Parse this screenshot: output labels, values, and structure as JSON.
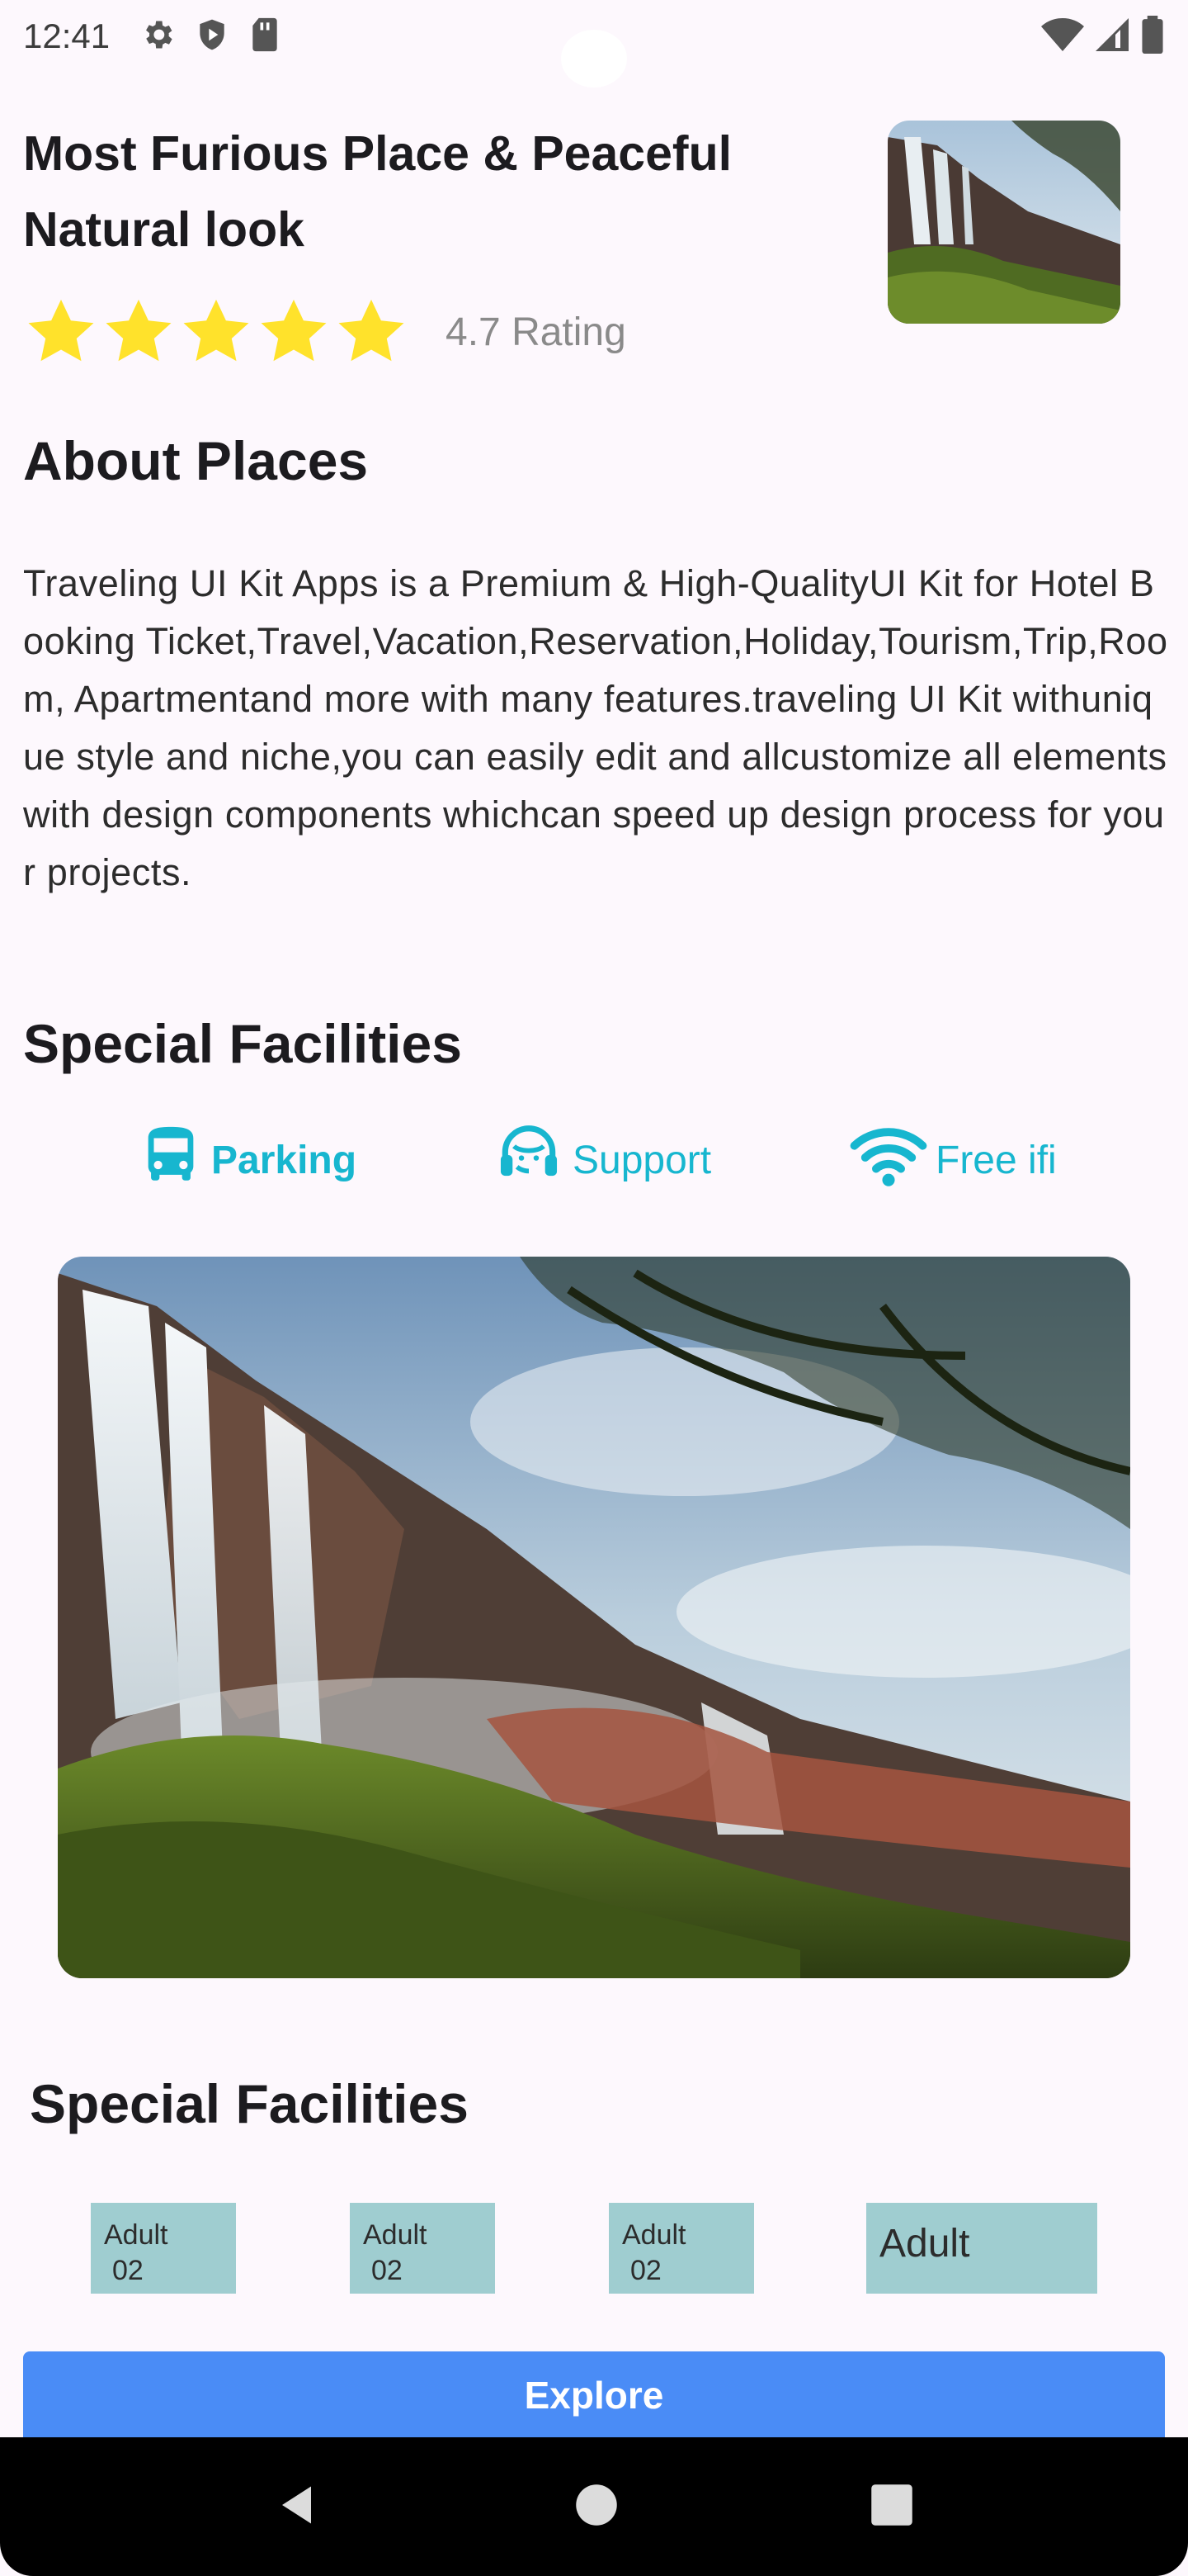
{
  "status_bar": {
    "time": "12:41",
    "icons_left": [
      "gear-icon",
      "shield-icon",
      "sd-card-icon"
    ],
    "icons_right": [
      "wifi-icon",
      "signal-icon",
      "battery-icon"
    ]
  },
  "header": {
    "title": "Most Furious Place & Peaceful Natural look",
    "rating_text": "4.7 Rating",
    "stars": 5,
    "star_color": "#ffe22b"
  },
  "about": {
    "heading": "About Places",
    "text": "Traveling UI Kit Apps is a Premium & High-QualityUI Kit for Hotel Booking Ticket,Travel,Vacation,Reservation,Holiday,Tourism,Trip,Room, Apartmentand more with many features.traveling UI Kit withunique style and niche,you can easily edit and allcustomize all elements with design components whichcan speed up design process for your projects."
  },
  "facilities": {
    "heading": "Special Facilities",
    "accent_color": "#17b6cf",
    "items": [
      {
        "label": "Parking",
        "icon": "bus-icon"
      },
      {
        "label": "Support",
        "icon": "headset-icon"
      },
      {
        "label": "Free ifi",
        "icon": "wifi-icon"
      }
    ]
  },
  "facilities_2": {
    "heading": "Special Facilities",
    "tickets": [
      {
        "label": "Adult",
        "count": "02"
      },
      {
        "label": "Adult",
        "count": "02"
      },
      {
        "label": "Adult",
        "count": "02"
      },
      {
        "label": "Adult",
        "count": ""
      }
    ]
  },
  "actions": {
    "explore_label": "Explore",
    "button_color": "#4a8cf6"
  },
  "nav": {
    "items": [
      "back-icon",
      "home-icon",
      "recents-icon"
    ]
  }
}
